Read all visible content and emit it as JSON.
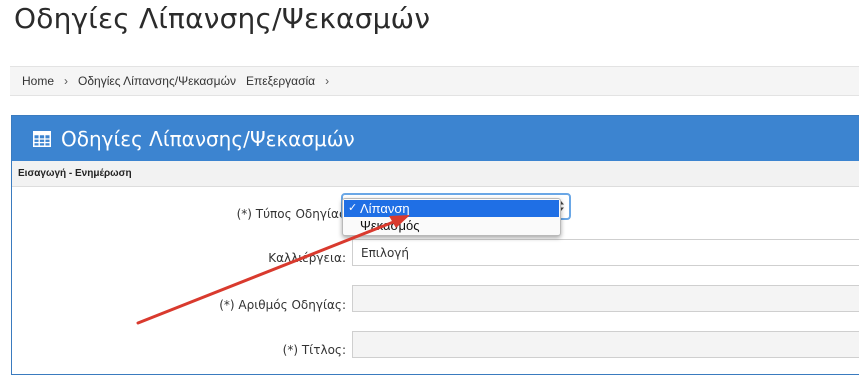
{
  "page": {
    "title": "Οδηγίες Λίπανσης/Ψεκασμών"
  },
  "breadcrumb": {
    "items": [
      "Home",
      "Οδηγίες Λίπανσης/Ψεκασμών",
      "Επεξεργασία"
    ],
    "separator": "›"
  },
  "panel": {
    "title": "Οδηγίες Λίπανσης/Ψεκασμών",
    "icon": "table-icon",
    "section_label": "Εισαγωγή - Ενημέρωση"
  },
  "form": {
    "type_label": "(*) Τύπος Οδηγίας",
    "type_dropdown": {
      "options": [
        "Λίπανση",
        "Ψεκασμός"
      ],
      "selected": "Λίπανση",
      "check_mark": "✓"
    },
    "crop_label": "Καλλιέργεια:",
    "crop_value": "Επιλογή",
    "number_label": "(*) Αριθμός Οδηγίας:",
    "number_value": "",
    "title_label": "(*) Τίτλος:",
    "title_value": ""
  },
  "colors": {
    "panel_heading": "#3c84d0",
    "selected_option": "#1f6fe5",
    "annotation_arrow": "#d93a2e"
  }
}
